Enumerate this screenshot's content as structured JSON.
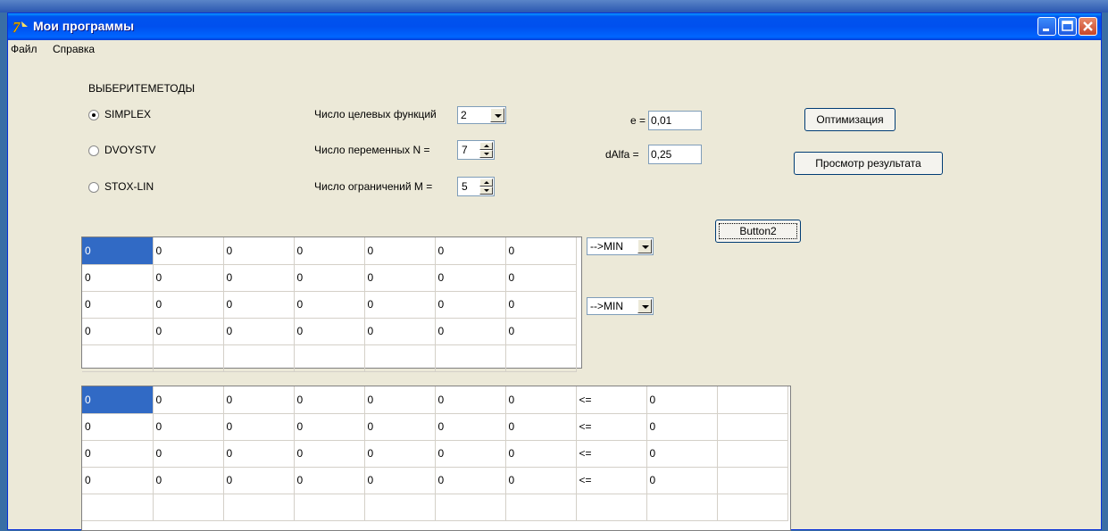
{
  "window": {
    "title": "Мои программы"
  },
  "menu": {
    "items": [
      "Файл",
      "Справка"
    ]
  },
  "methods": {
    "heading": "ВЫБЕРИТЕМЕТОДЫ",
    "options": [
      "SIMPLEX",
      "DVOYSTV",
      "STOX-LIN"
    ],
    "selected": "SIMPLEX"
  },
  "params": {
    "target_label": "Число целевых функций",
    "target_value": "2",
    "vars_label": "Число переменных N =",
    "vars_value": "7",
    "cons_label": "Число ограничений M =",
    "cons_value": "5",
    "e_label": "e =",
    "e_value": "0,01",
    "dalfa_label": "dAlfa =",
    "dalfa_value": "0,25"
  },
  "buttons": {
    "optimize": "Оптимизация",
    "view_result": "Просмотр результата",
    "button2": "Button2"
  },
  "goal_combos": [
    "-->MIN",
    "-->MIN"
  ],
  "objective_grid": {
    "rows": [
      [
        "0",
        "0",
        "0",
        "0",
        "0",
        "0",
        "0"
      ],
      [
        "0",
        "0",
        "0",
        "0",
        "0",
        "0",
        "0"
      ],
      [
        "0",
        "0",
        "0",
        "0",
        "0",
        "0",
        "0"
      ],
      [
        "0",
        "0",
        "0",
        "0",
        "0",
        "0",
        "0"
      ],
      [
        "",
        "",
        "",
        "",
        "",
        "",
        ""
      ]
    ]
  },
  "constraint_grid": {
    "rows": [
      [
        "0",
        "0",
        "0",
        "0",
        "0",
        "0",
        "0",
        "<=",
        "0",
        ""
      ],
      [
        "0",
        "0",
        "0",
        "0",
        "0",
        "0",
        "0",
        "<=",
        "0",
        ""
      ],
      [
        "0",
        "0",
        "0",
        "0",
        "0",
        "0",
        "0",
        "<=",
        "0",
        ""
      ],
      [
        "0",
        "0",
        "0",
        "0",
        "0",
        "0",
        "0",
        "<=",
        "0",
        ""
      ],
      [
        "",
        "",
        "",
        "",
        "",
        "",
        "",
        "",
        "",
        ""
      ]
    ]
  },
  "colors": {
    "titlebar": "#0053ee",
    "selection": "#316ac5",
    "face": "#ece9d8"
  }
}
